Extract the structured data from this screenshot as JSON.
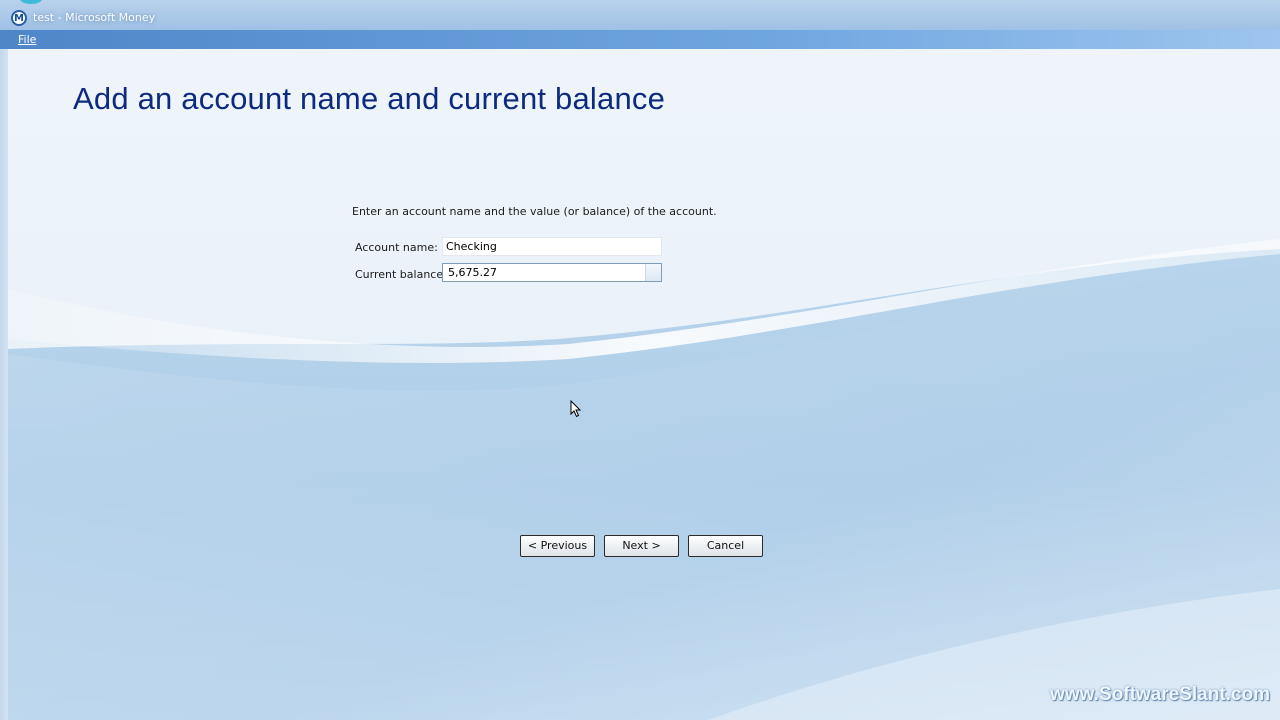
{
  "window": {
    "title": "test - Microsoft Money",
    "app_icon_letter": "M"
  },
  "menu": {
    "file_label": "File"
  },
  "page": {
    "title": "Add an account name and current balance",
    "instruction": "Enter an account name and the value (or balance) of the account."
  },
  "form": {
    "account_name_label": "Account name:",
    "account_name_value": "Checking",
    "current_balance_label": "Current balance:",
    "current_balance_value": "5,675.27"
  },
  "buttons": {
    "previous_label": "< Previous",
    "next_label": "Next >",
    "cancel_label": "Cancel"
  },
  "watermark": "www.SoftwareSlant.com",
  "colors": {
    "title_text": "#0e2a7e",
    "menubar": "#4f86c8",
    "background_light": "#eef4fa",
    "background_wave": "#b7d3ea"
  }
}
